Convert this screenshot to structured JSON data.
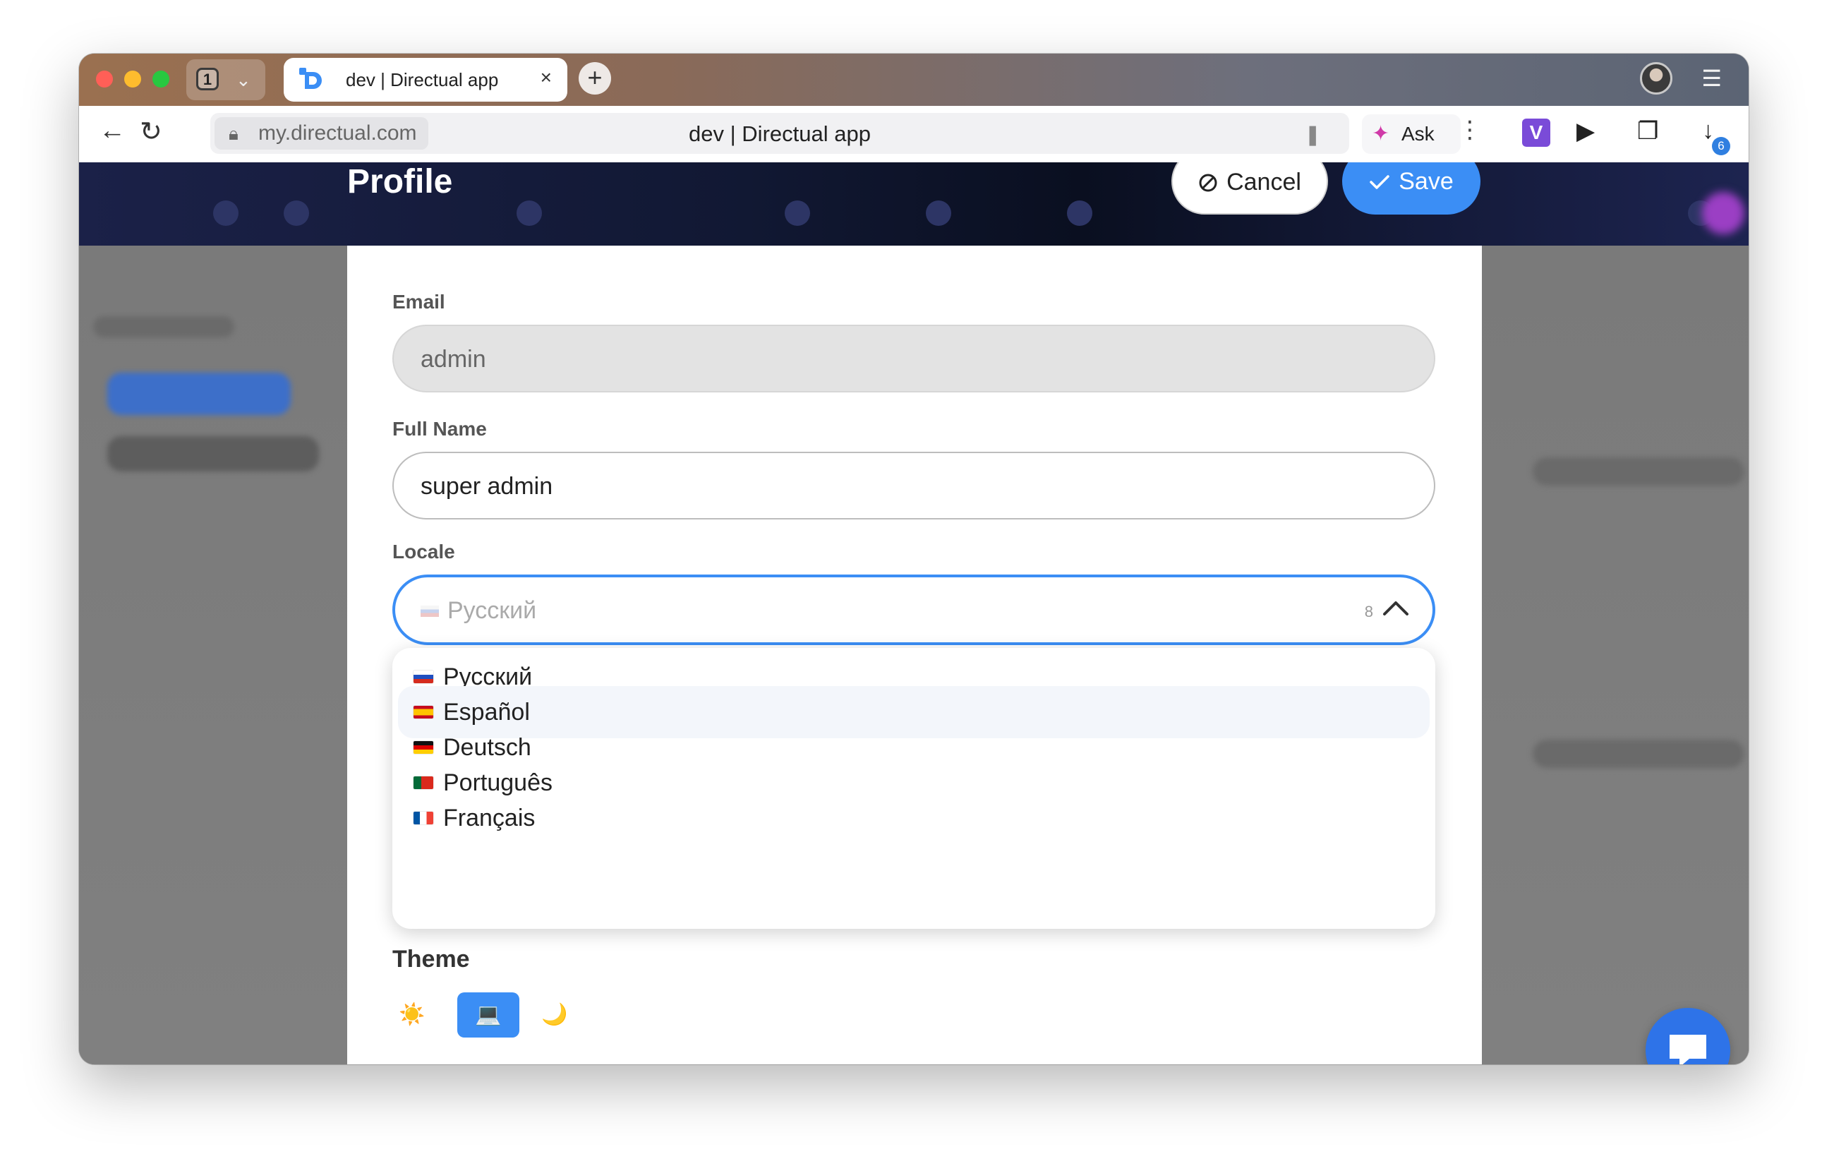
{
  "browser": {
    "tab_count": "1",
    "tab_title": "dev | Directual app",
    "url_domain": "my.directual.com",
    "page_title": "dev | Directual app",
    "ask_label": "Ask",
    "downloads_badge": "6",
    "icons": [
      "tab-close-icon",
      "new-tab-icon",
      "back-icon",
      "reload-icon",
      "lock-icon",
      "bookmark-icon",
      "ask-ai-icon",
      "more-icon",
      "vpn-extension-icon",
      "video-extension-icon",
      "extension-icon",
      "download-icon",
      "menu-icon"
    ]
  },
  "modal": {
    "title": "Profile",
    "cancel_label": "Cancel",
    "save_label": "Save",
    "fields": {
      "email_label": "Email",
      "email_value": "admin",
      "fullname_label": "Full Name",
      "fullname_value": "super admin",
      "locale_label": "Locale",
      "locale_value": "Русский",
      "locale_count": "8"
    },
    "locale_options": [
      {
        "label": "Русский",
        "flag": "ru"
      },
      {
        "label": "Español",
        "flag": "es"
      },
      {
        "label": "Deutsch",
        "flag": "de"
      },
      {
        "label": "Português",
        "flag": "pt"
      },
      {
        "label": "Français",
        "flag": "fr"
      }
    ],
    "highlighted_option": "Español",
    "theme_label": "Theme",
    "theme_options": [
      "☀️",
      "💻",
      "🌙"
    ],
    "theme_selected": "💻"
  },
  "colors": {
    "accent": "#3b8ef5",
    "chat_button": "#2e73e8",
    "header_bg": "#111833"
  }
}
